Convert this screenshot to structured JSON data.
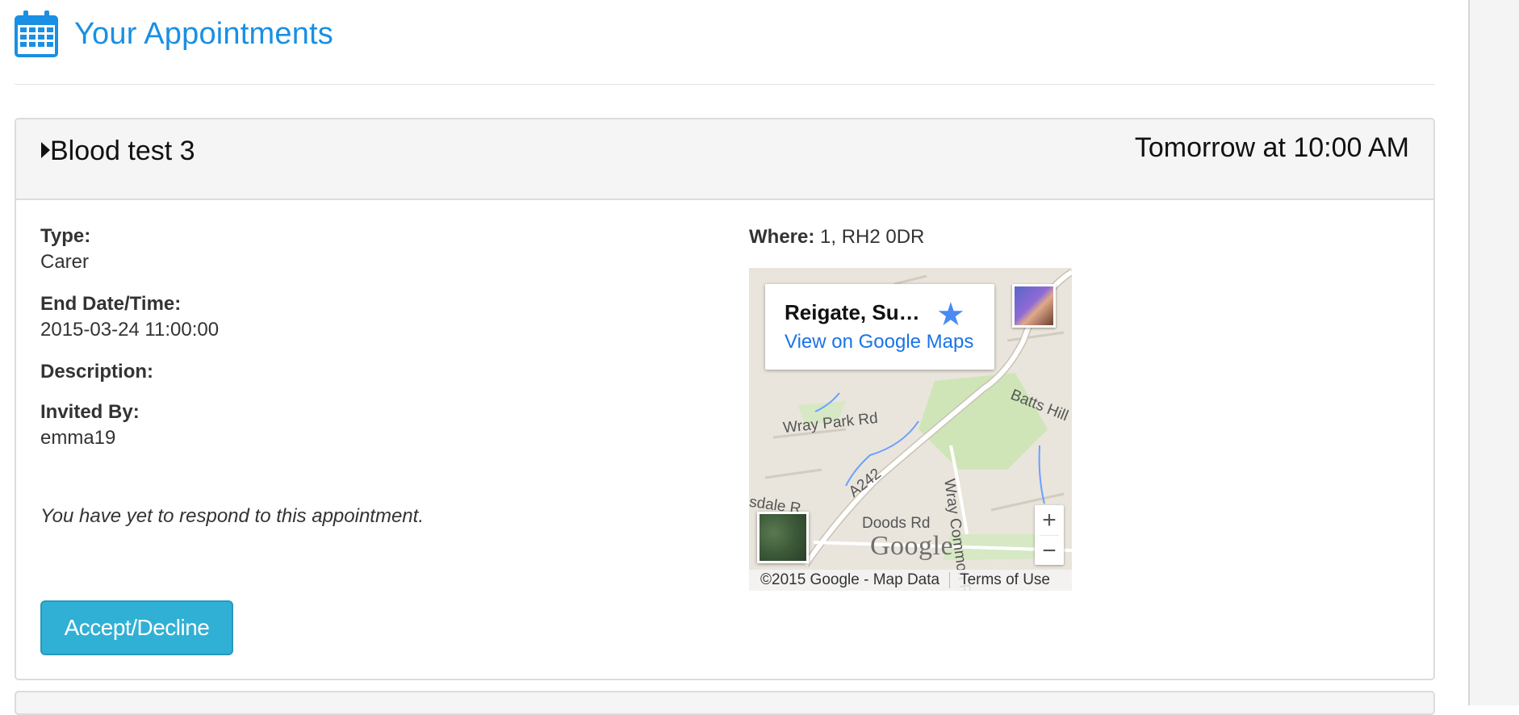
{
  "header": {
    "icon": "calendar-icon",
    "title": "Your Appointments",
    "title_color": "#1a8fe3"
  },
  "appointment": {
    "title": "Blood test 3",
    "when": "Tomorrow at 10:00 AM",
    "fields": [
      {
        "label": "Type:",
        "value": "Carer"
      },
      {
        "label": "End Date/Time:",
        "value": "2015-03-24 11:00:00"
      },
      {
        "label": "Description:",
        "value": ""
      },
      {
        "label": "Invited By:",
        "value": "emma19"
      }
    ],
    "notice": "You have yet to respond to this appointment.",
    "accept_label": "Accept/Decline",
    "accept_color": "#31b0d5",
    "where_label": "Where:",
    "where_value": " 1, RH2 0DR"
  },
  "map": {
    "place_title": "Reigate, Su…",
    "link": "View on Google Maps",
    "streets": [
      "Wray Park Rd",
      "Batts Hill",
      "A242",
      "Wray Common Rd",
      "Doods Rd",
      "sdale R"
    ],
    "logo": "Google",
    "zoom_in": "+",
    "zoom_out": "−",
    "copyright": "©2015 Google - Map Data",
    "terms": "Terms of Use"
  }
}
